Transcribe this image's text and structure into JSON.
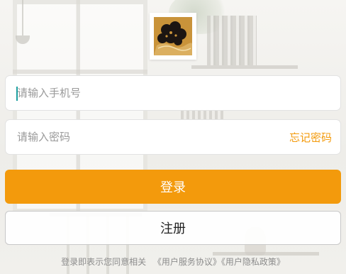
{
  "login_form": {
    "phone_placeholder": "请输入手机号",
    "password_placeholder": "请输入密码",
    "forgot_password": "忘记密码",
    "login_button": "登录",
    "register_button": "注册"
  },
  "agreement": {
    "prefix": "登录即表示您同意相关",
    "user_service_agreement": "《用户服务协议》",
    "privacy_policy": "《用户隐私政策》"
  },
  "colors": {
    "accent": "#f39a0c",
    "logo_gold": "#c9933a",
    "logo_dark": "#1c1512"
  },
  "icons": {
    "logo": "flower-emblem-icon"
  }
}
